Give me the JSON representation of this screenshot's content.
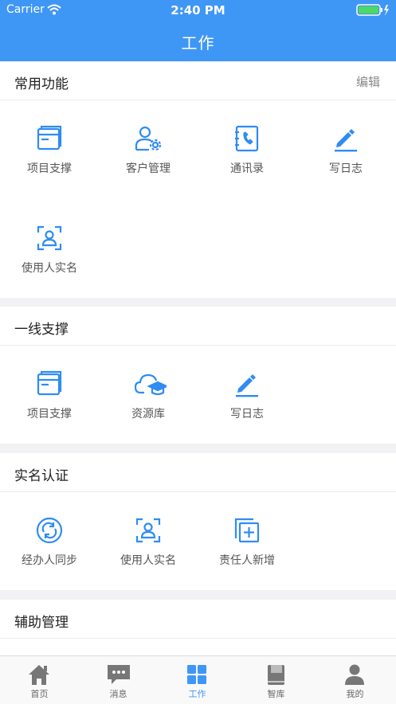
{
  "status_bar": {
    "carrier": "Carrier",
    "time": "2:40 PM"
  },
  "nav": {
    "title": "工作"
  },
  "colors": {
    "accent": "#3f97f5",
    "icon": "#2f8cf3"
  },
  "sections": {
    "common": {
      "title": "常用功能",
      "action": "编辑",
      "items": [
        {
          "label": "项目支撑",
          "icon": "folder-icon"
        },
        {
          "label": "客户管理",
          "icon": "user-settings-icon"
        },
        {
          "label": "通讯录",
          "icon": "phone-book-icon"
        },
        {
          "label": "写日志",
          "icon": "pencil-icon"
        },
        {
          "label": "使用人实名",
          "icon": "face-scan-icon"
        }
      ]
    },
    "frontline": {
      "title": "一线支撑",
      "items": [
        {
          "label": "项目支撑",
          "icon": "folder-icon"
        },
        {
          "label": "资源库",
          "icon": "cloud-graduation-icon"
        },
        {
          "label": "写日志",
          "icon": "pencil-icon"
        }
      ]
    },
    "realname": {
      "title": "实名认证",
      "items": [
        {
          "label": "经办人同步",
          "icon": "sync-icon"
        },
        {
          "label": "使用人实名",
          "icon": "face-scan-icon"
        },
        {
          "label": "责任人新增",
          "icon": "add-copy-icon"
        }
      ]
    },
    "assist": {
      "title": "辅助管理"
    }
  },
  "tabbar": {
    "tabs": [
      {
        "label": "首页",
        "icon": "home-icon"
      },
      {
        "label": "消息",
        "icon": "message-icon"
      },
      {
        "label": "工作",
        "icon": "grid-icon",
        "active": true
      },
      {
        "label": "智库",
        "icon": "book-icon"
      },
      {
        "label": "我的",
        "icon": "person-icon"
      }
    ]
  }
}
